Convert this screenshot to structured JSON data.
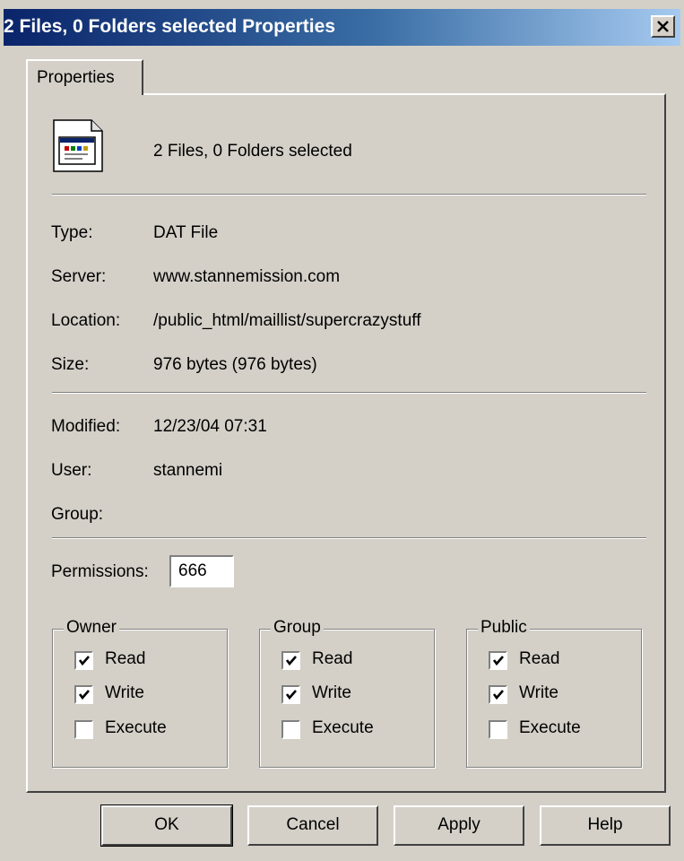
{
  "window": {
    "title": "2 Files, 0 Folders selected Properties"
  },
  "tabs": [
    {
      "label": "Properties"
    }
  ],
  "header": {
    "icon": "document-icon",
    "summary": "2 Files, 0 Folders selected"
  },
  "info": {
    "type_label": "Type:",
    "type_value": "DAT File",
    "server_label": "Server:",
    "server_value": "www.stannemission.com",
    "location_label": "Location:",
    "location_value": "/public_html/maillist/supercrazystuff",
    "size_label": "Size:",
    "size_value": "976 bytes (976 bytes)",
    "modified_label": "Modified:",
    "modified_value": "12/23/04 07:31",
    "user_label": "User:",
    "user_value": "stannemi",
    "group_label": "Group:",
    "group_value": ""
  },
  "permissions": {
    "label": "Permissions:",
    "value": "666",
    "groups": [
      {
        "legend": "Owner",
        "read": "Read",
        "write": "Write",
        "execute": "Execute",
        "read_checked": true,
        "write_checked": true,
        "execute_checked": false
      },
      {
        "legend": "Group",
        "read": "Read",
        "write": "Write",
        "execute": "Execute",
        "read_checked": true,
        "write_checked": true,
        "execute_checked": false
      },
      {
        "legend": "Public",
        "read": "Read",
        "write": "Write",
        "execute": "Execute",
        "read_checked": true,
        "write_checked": true,
        "execute_checked": false
      }
    ]
  },
  "buttons": {
    "ok": "OK",
    "cancel": "Cancel",
    "apply": "Apply",
    "help": "Help"
  },
  "colors": {
    "titlebar_start": "#0a246a",
    "titlebar_end": "#a6caf0",
    "face": "#d4d0c8"
  }
}
